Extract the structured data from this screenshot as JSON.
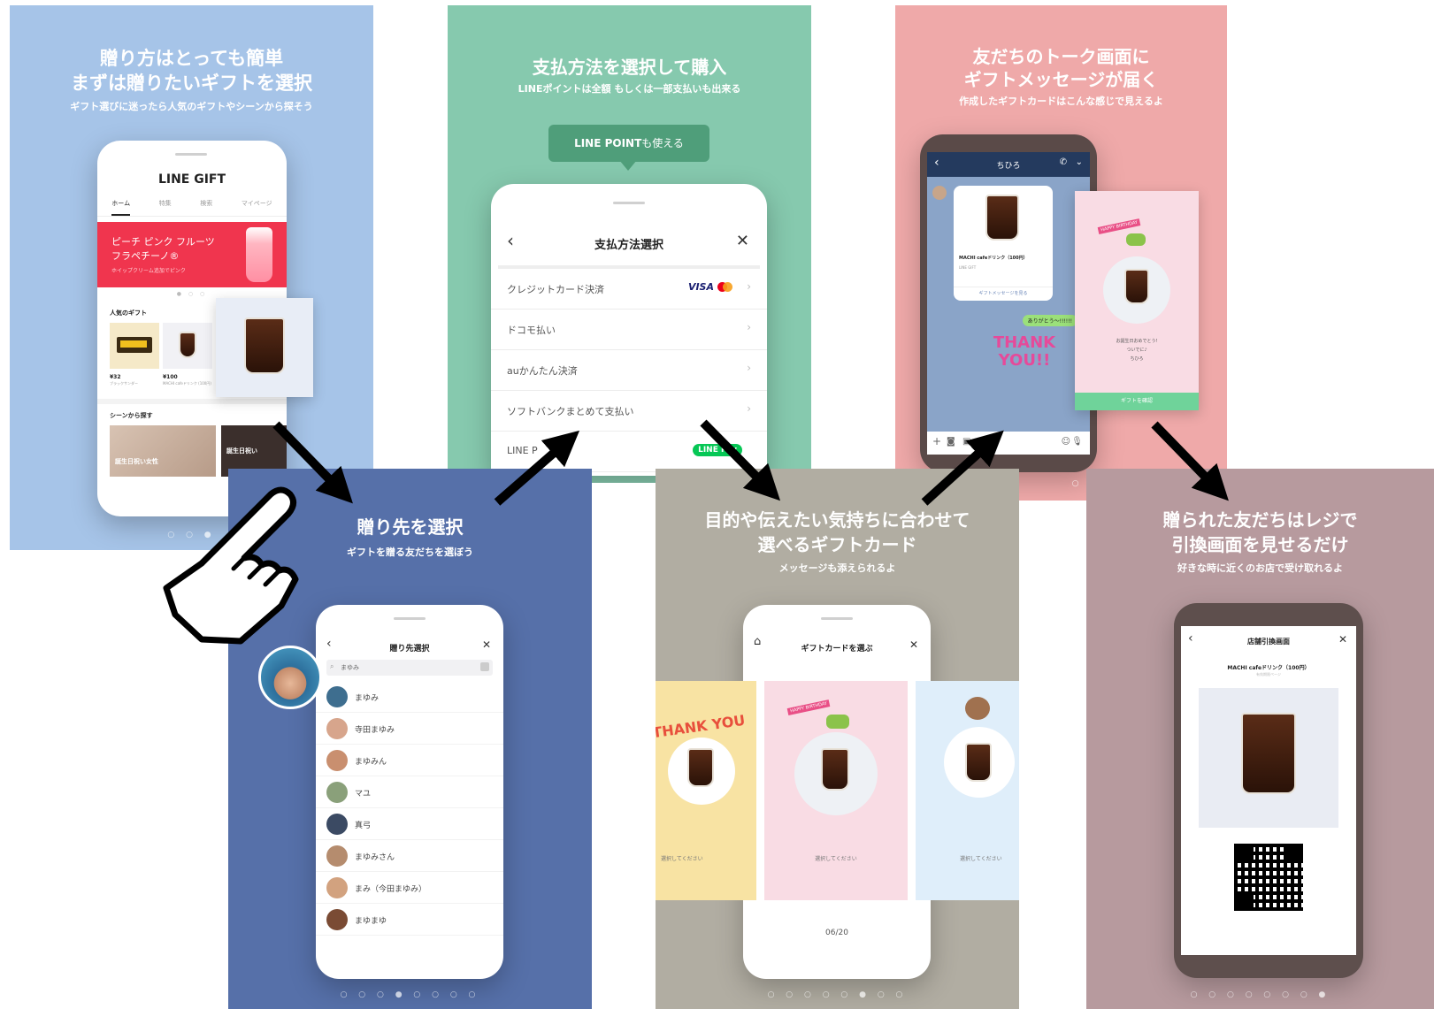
{
  "panel1": {
    "title1": "贈り方はとっても簡単",
    "title2": "まずは贈りたいギフトを選択",
    "subtitle": "ギフト選びに迷ったら人気のギフトやシーンから探そう",
    "app_title": "LINE GIFT",
    "tabs": [
      "ホーム",
      "特集",
      "検索",
      "マイページ"
    ],
    "banner_line1": "ピーチ ピンク フルーツ",
    "banner_line2": "フラペチーノ®",
    "banner_small": "ホイップクリーム追加でピンク",
    "popular_label": "人気のギフト",
    "price1": "¥32",
    "item1_name": "ブラックサンダー",
    "price2": "¥100",
    "item2_name": "MACHI cafeドリンク (100円)",
    "scene_label": "シーンから探す",
    "scene_tag1": "誕生日祝い女性",
    "scene_tag2": "誕生日祝い"
  },
  "panel2": {
    "title": "支払方法を選択して購入",
    "subtitle": "LINEポイントは全額 もしくは一部支払いも出来る",
    "bubble_bold": "LINE POINT",
    "bubble_rest": "も使える",
    "header": "支払方法選択",
    "rows": [
      "クレジットカード決済",
      "ドコモ払い",
      "auかんたん決済",
      "ソフトバンクまとめて支払い",
      "LINE P"
    ],
    "visa": "VISA",
    "linepay": "LINE Pay"
  },
  "panel3": {
    "title1": "友だちのトーク画面に",
    "title2": "ギフトメッセージが届く",
    "subtitle": "作成したギフトカードはこんな感じで見えるよ",
    "chat_name": "ちひろ",
    "card_item": "MACHI cafeドリンク（100円）",
    "card_brand": "LINE GIFT",
    "card_link": "ギフトメッセージを見る",
    "reply": "ありがとう〜!!!!!!",
    "sticker": "THANK YOU!!",
    "popup_badge": "HAPPY BIRTHDAY",
    "popup_msg1": "お誕生日おめでとう!",
    "popup_msg2": "ついでに♪",
    "popup_msg3": "ちひろ",
    "popup_button": "ギフトを確認"
  },
  "panel4": {
    "title": "贈り先を選択",
    "subtitle": "ギフトを贈る友だちを選ぼう",
    "header": "贈り先選択",
    "search_value": "まゆみ",
    "friends": [
      "まゆみ",
      "寺田まゆみ",
      "まゆみん",
      "マユ",
      "真弓",
      "まゆみさん",
      "まみ（今田まゆみ）",
      "まゆまゆ"
    ]
  },
  "panel5": {
    "title1": "目的や伝えたい気持ちに合わせて",
    "title2": "選べるギフトカード",
    "subtitle": "メッセージも添えられるよ",
    "header": "ギフトカードを選ぶ",
    "card_left_text": "THANK YOU",
    "card_mid_badge": "HAPPY BIRTHDAY",
    "select_label": "選択してください",
    "counter": "06/20"
  },
  "panel6": {
    "title1": "贈られた友だちはレジで",
    "title2": "引換画面を見せるだけ",
    "subtitle": "好きな時に近くのお店で受け取れるよ",
    "header": "店舗引換画面",
    "item": "MACHI cafeドリンク（100円）",
    "item_sub": "有効期限ページ"
  },
  "colors": {
    "p1": "#a6c4e8",
    "p2": "#86c9ae",
    "p3": "#efa9a9",
    "p4": "#5670a9",
    "p5": "#b1ada2",
    "p6": "#b79a9e",
    "line_green": "#06c755"
  }
}
